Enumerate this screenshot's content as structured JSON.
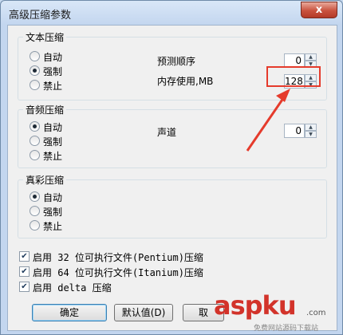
{
  "window": {
    "title": "高级压缩参数",
    "close_glyph": "x"
  },
  "text_group": {
    "label": "文本压缩",
    "options": [
      "自动",
      "强制",
      "禁止"
    ],
    "selected": 1,
    "predict_order_label": "预测顺序",
    "predict_order_value": "0",
    "memory_label": "内存使用,MB",
    "memory_value": "128"
  },
  "audio_group": {
    "label": "音频压缩",
    "options": [
      "自动",
      "强制",
      "禁止"
    ],
    "selected": 0,
    "channel_label": "声道",
    "channel_value": "0"
  },
  "truecolor_group": {
    "label": "真彩压缩",
    "options": [
      "自动",
      "强制",
      "禁止"
    ],
    "selected": 0
  },
  "checkboxes": [
    {
      "label": "启用 32 位可执行文件(Pentium)压缩",
      "checked": true
    },
    {
      "label": "启用 64 位可执行文件(Itanium)压缩",
      "checked": true
    },
    {
      "label": "启用 delta 压缩",
      "checked": true
    }
  ],
  "buttons": {
    "ok": "确定",
    "default": "默认值(D)",
    "cancel": "取"
  },
  "watermark": {
    "main": "aspku",
    "sub": "免费网站源码下载站",
    "tld": ".com"
  },
  "colors": {
    "highlight": "#e53b2c",
    "titlebar": "#c3d6ef",
    "client": "#f0f0f0"
  }
}
